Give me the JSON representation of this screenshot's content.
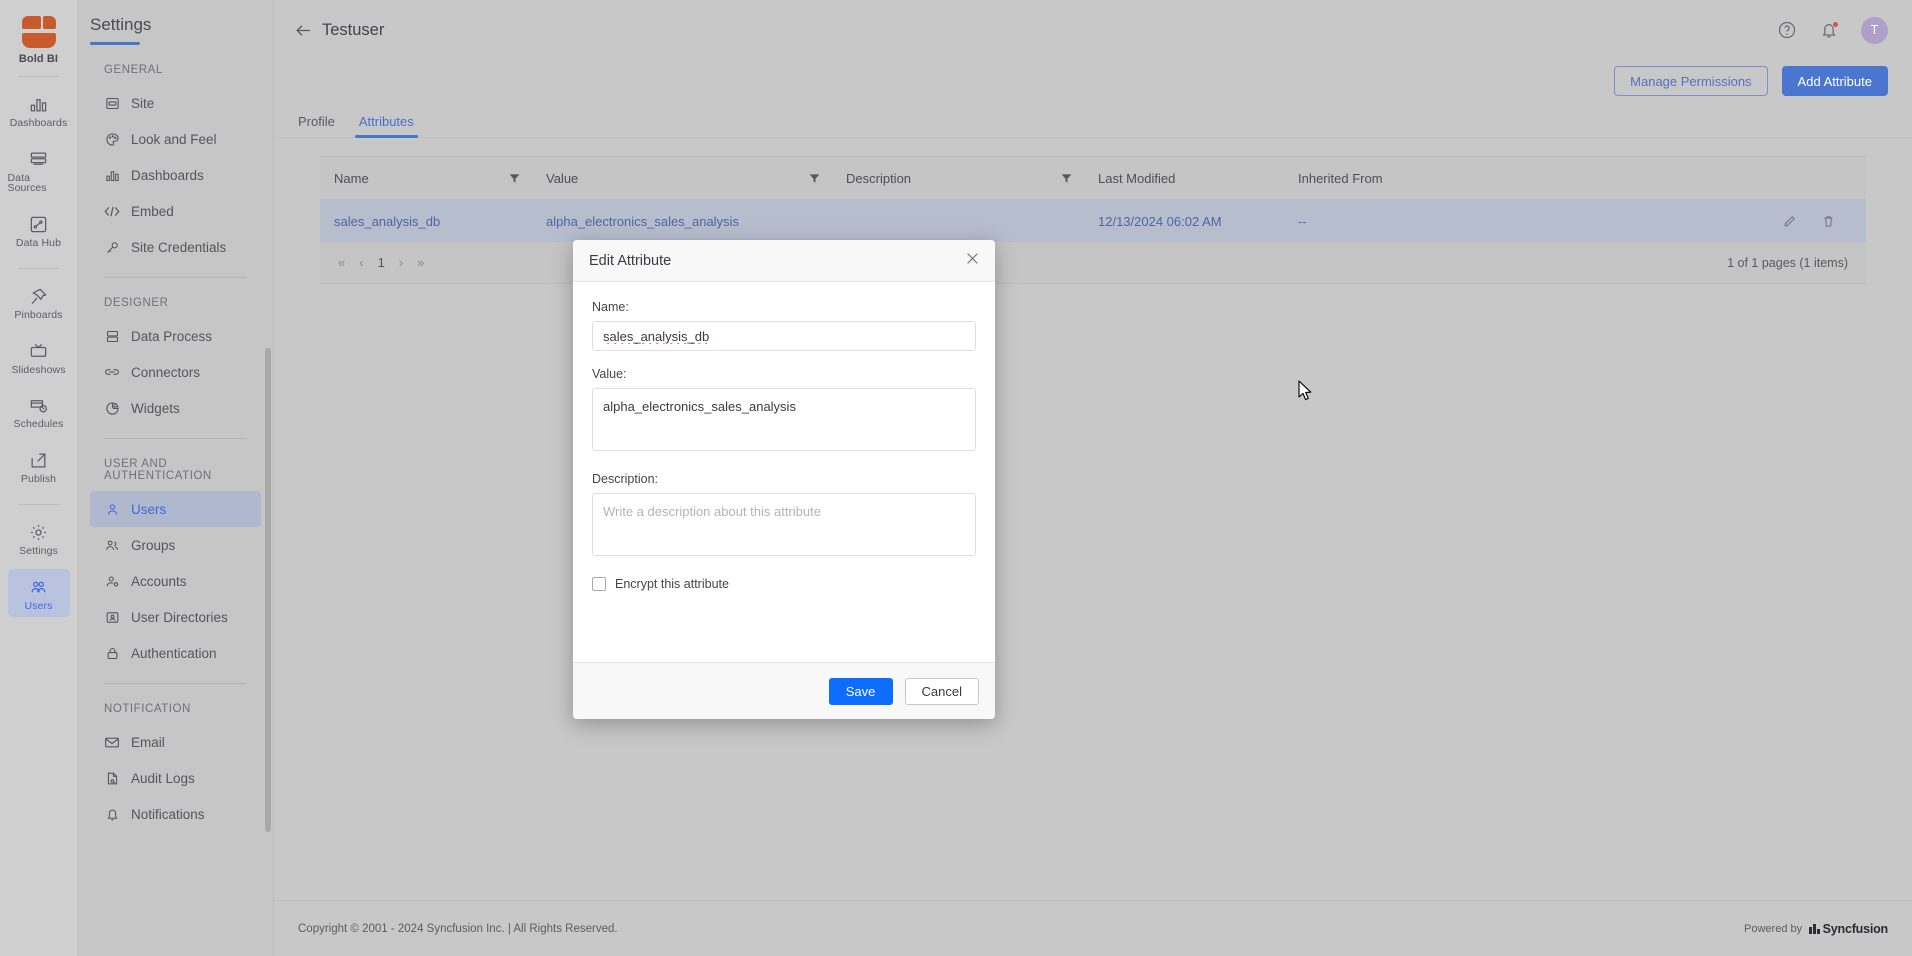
{
  "rail": {
    "logo_label": "Bold BI",
    "items": [
      {
        "label": "Dashboards",
        "icon": "bar-chart-icon",
        "active": false
      },
      {
        "label": "Data Sources",
        "icon": "database-icon",
        "active": false
      },
      {
        "label": "Data Hub",
        "icon": "data-hub-icon",
        "active": false
      },
      {
        "label": "Pinboards",
        "icon": "pin-icon",
        "active": false
      },
      {
        "label": "Slideshows",
        "icon": "slideshow-icon",
        "active": false
      },
      {
        "label": "Schedules",
        "icon": "schedule-icon",
        "active": false
      },
      {
        "label": "Publish",
        "icon": "publish-icon",
        "active": false
      },
      {
        "label": "Settings",
        "icon": "gear-icon",
        "active": false
      },
      {
        "label": "Users",
        "icon": "users-icon",
        "active": true
      }
    ]
  },
  "settings_nav": {
    "title": "Settings",
    "groups": [
      {
        "label": "GENERAL",
        "items": [
          {
            "label": "Site",
            "icon": "site-icon",
            "active": false
          },
          {
            "label": "Look and Feel",
            "icon": "palette-icon",
            "active": false
          },
          {
            "label": "Dashboards",
            "icon": "bar-chart-icon",
            "active": false
          },
          {
            "label": "Embed",
            "icon": "code-icon",
            "active": false
          },
          {
            "label": "Site Credentials",
            "icon": "key-icon",
            "active": false
          }
        ]
      },
      {
        "label": "DESIGNER",
        "items": [
          {
            "label": "Data Process",
            "icon": "data-process-icon",
            "active": false
          },
          {
            "label": "Connectors",
            "icon": "link-icon",
            "active": false
          },
          {
            "label": "Widgets",
            "icon": "widgets-icon",
            "active": false
          }
        ]
      },
      {
        "label": "USER AND AUTHENTICATION",
        "items": [
          {
            "label": "Users",
            "icon": "user-icon",
            "active": true
          },
          {
            "label": "Groups",
            "icon": "group-icon",
            "active": false
          },
          {
            "label": "Accounts",
            "icon": "account-icon",
            "active": false
          },
          {
            "label": "User Directories",
            "icon": "id-card-icon",
            "active": false
          },
          {
            "label": "Authentication",
            "icon": "lock-icon",
            "active": false
          }
        ]
      },
      {
        "label": "NOTIFICATION",
        "items": [
          {
            "label": "Email",
            "icon": "mail-icon",
            "active": false
          },
          {
            "label": "Audit Logs",
            "icon": "audit-log-icon",
            "active": false
          },
          {
            "label": "Notifications",
            "icon": "bell-icon",
            "active": false
          }
        ]
      }
    ]
  },
  "header": {
    "title": "Testuser",
    "back_icon": "back-arrow-icon",
    "help_icon": "help-circle-icon",
    "notification_icon": "bell-icon",
    "avatar_initial": "T"
  },
  "actions": {
    "manage_permissions": "Manage Permissions",
    "add_attribute": "Add Attribute"
  },
  "tabs": [
    {
      "label": "Profile",
      "active": false
    },
    {
      "label": "Attributes",
      "active": true
    }
  ],
  "grid": {
    "columns": [
      {
        "label": "Name",
        "filter": true
      },
      {
        "label": "Value",
        "filter": true
      },
      {
        "label": "Description",
        "filter": true
      },
      {
        "label": "Last Modified",
        "filter": false
      },
      {
        "label": "Inherited From",
        "filter": false
      }
    ],
    "rows": [
      {
        "name": "sales_analysis_db",
        "value": "alpha_electronics_sales_analysis",
        "description": "",
        "last_modified": "12/13/2024 06:02 AM",
        "inherited_from": "--",
        "edit_icon": "pencil-icon",
        "delete_icon": "trash-icon"
      }
    ],
    "pager": {
      "first": "«",
      "prev": "‹",
      "page": "1",
      "next": "›",
      "last": "»"
    },
    "summary": "1 of 1 pages (1 items)"
  },
  "modal": {
    "title": "Edit Attribute",
    "close_icon": "close-icon",
    "name_label": "Name:",
    "name_value": "sales_analysis_db",
    "value_label": "Value:",
    "value_value": "alpha_electronics_sales_analysis",
    "description_label": "Description:",
    "description_value": "",
    "description_placeholder": "Write a description about this attribute",
    "encrypt_label": "Encrypt this attribute",
    "encrypt_checked": false,
    "save_label": "Save",
    "cancel_label": "Cancel"
  },
  "footer": {
    "copyright": "Copyright © 2001 - 2024 Syncfusion Inc. | All Rights Reserved.",
    "powered_by": "Powered by",
    "brand": "Syncfusion"
  },
  "colors": {
    "accent_blue": "#4579c7",
    "primary_button": "#4a76cf",
    "save_button": "#0d6efd",
    "logo_orange": "#c75b2e",
    "link_blue": "#5164a4",
    "notification_dot": "#d9534f",
    "avatar_bg": "#b09ecb"
  }
}
